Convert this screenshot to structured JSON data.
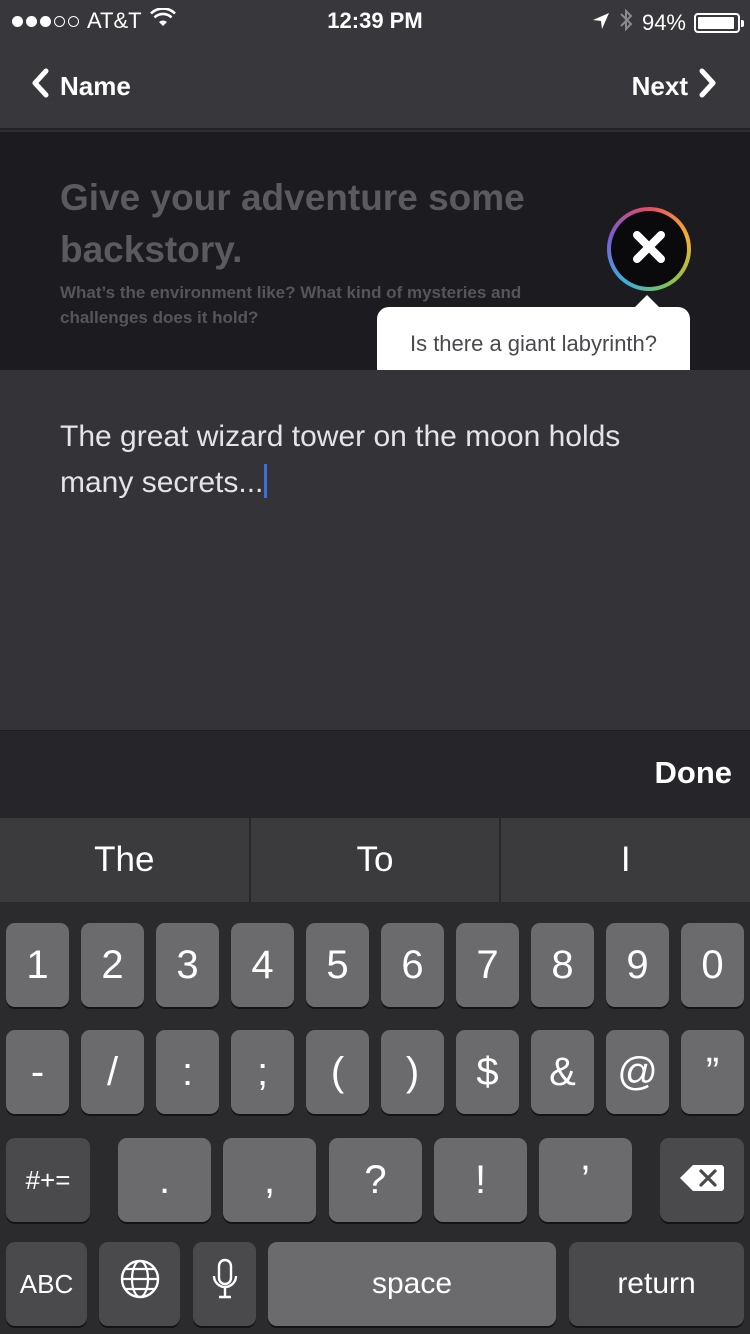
{
  "status_bar": {
    "carrier": "AT&T",
    "time": "12:39 PM",
    "battery": "94%",
    "battery_level": 0.94,
    "signal_bars": 3,
    "icons": [
      "wifi-icon",
      "location-icon",
      "bluetooth-icon",
      "battery-icon"
    ]
  },
  "nav": {
    "back_label": "Name",
    "next_label": "Next"
  },
  "prompt": {
    "title": "Give your adventure some backstory.",
    "subtitle": "What’s the environment like? What kind of mysteries and challenges does it hold?",
    "tooltip": "Is there a giant labyrinth?"
  },
  "editor": {
    "text": "The great wizard tower on the moon holds many secrets..."
  },
  "done_label": "Done",
  "keyboard": {
    "predictions": [
      "The",
      "To",
      "I"
    ],
    "row1": [
      "1",
      "2",
      "3",
      "4",
      "5",
      "6",
      "7",
      "8",
      "9",
      "0"
    ],
    "row2": [
      "-",
      "/",
      ":",
      ";",
      "(",
      ")",
      "$",
      "&",
      "@",
      "”"
    ],
    "row3": [
      ".",
      ",",
      "?",
      "!",
      "’"
    ],
    "symbols_label": "#+=",
    "abc_label": "ABC",
    "space_label": "space",
    "return_label": "return"
  }
}
